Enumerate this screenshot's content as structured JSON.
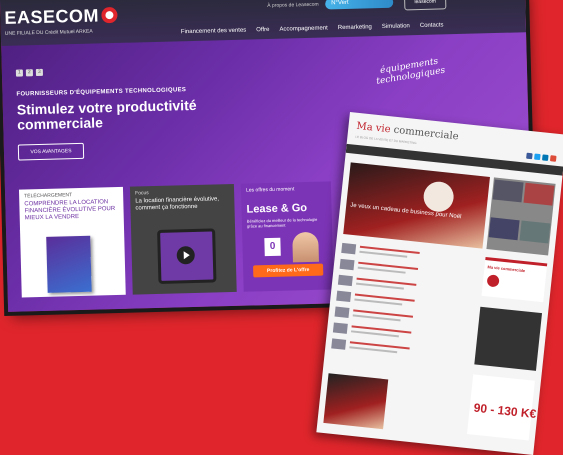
{
  "site1": {
    "logo": "EASECOM",
    "logo_sub": "UNE FILIALE DU Crédit Mutuel ARKEA",
    "util_link": "À propos de Leasecom",
    "phone": "N°Vert",
    "client_btn": "leasecom",
    "nav": [
      "Financement des ventes",
      "Offre",
      "Accompagnement",
      "Remarketing",
      "Simulation",
      "Contacts"
    ],
    "pager": [
      "1",
      "2",
      "3"
    ],
    "hero_kicker": "FOURNISSEURS D'ÉQUIPEMENTS TECHNOLOGIQUES",
    "hero_title": "Stimulez votre productivité commerciale",
    "hero_handwritten": "équipements technologiques",
    "hero_button": "VOS AVANTAGES",
    "card1": {
      "tag": "TÉLÉCHARGEMENT",
      "title": "COMPRENDRE LA LOCATION FINANCIÈRE ÉVOLUTIVE POUR MIEUX LA VENDRE"
    },
    "card2": {
      "tag": "Focus",
      "title": "La location financière évolutive, comment ça fonctionne"
    },
    "card3": {
      "tag": "Les offres du moment",
      "lease": "Lease & Go",
      "sub": "Bénéficiez du meilleur de la technologie grâce au financement",
      "zero": "0",
      "button": "Profitez de L'offre"
    }
  },
  "site2": {
    "title_main": "Ma vie",
    "title_rest": " commerciale",
    "tagline": "LE BLOG DE LA VENTE ET DU MARKETING",
    "hero_text": "Je veux un cadeau de business pour Noël",
    "ad_title": "Ma vie commerciale",
    "price": "90 - 130 K€"
  }
}
